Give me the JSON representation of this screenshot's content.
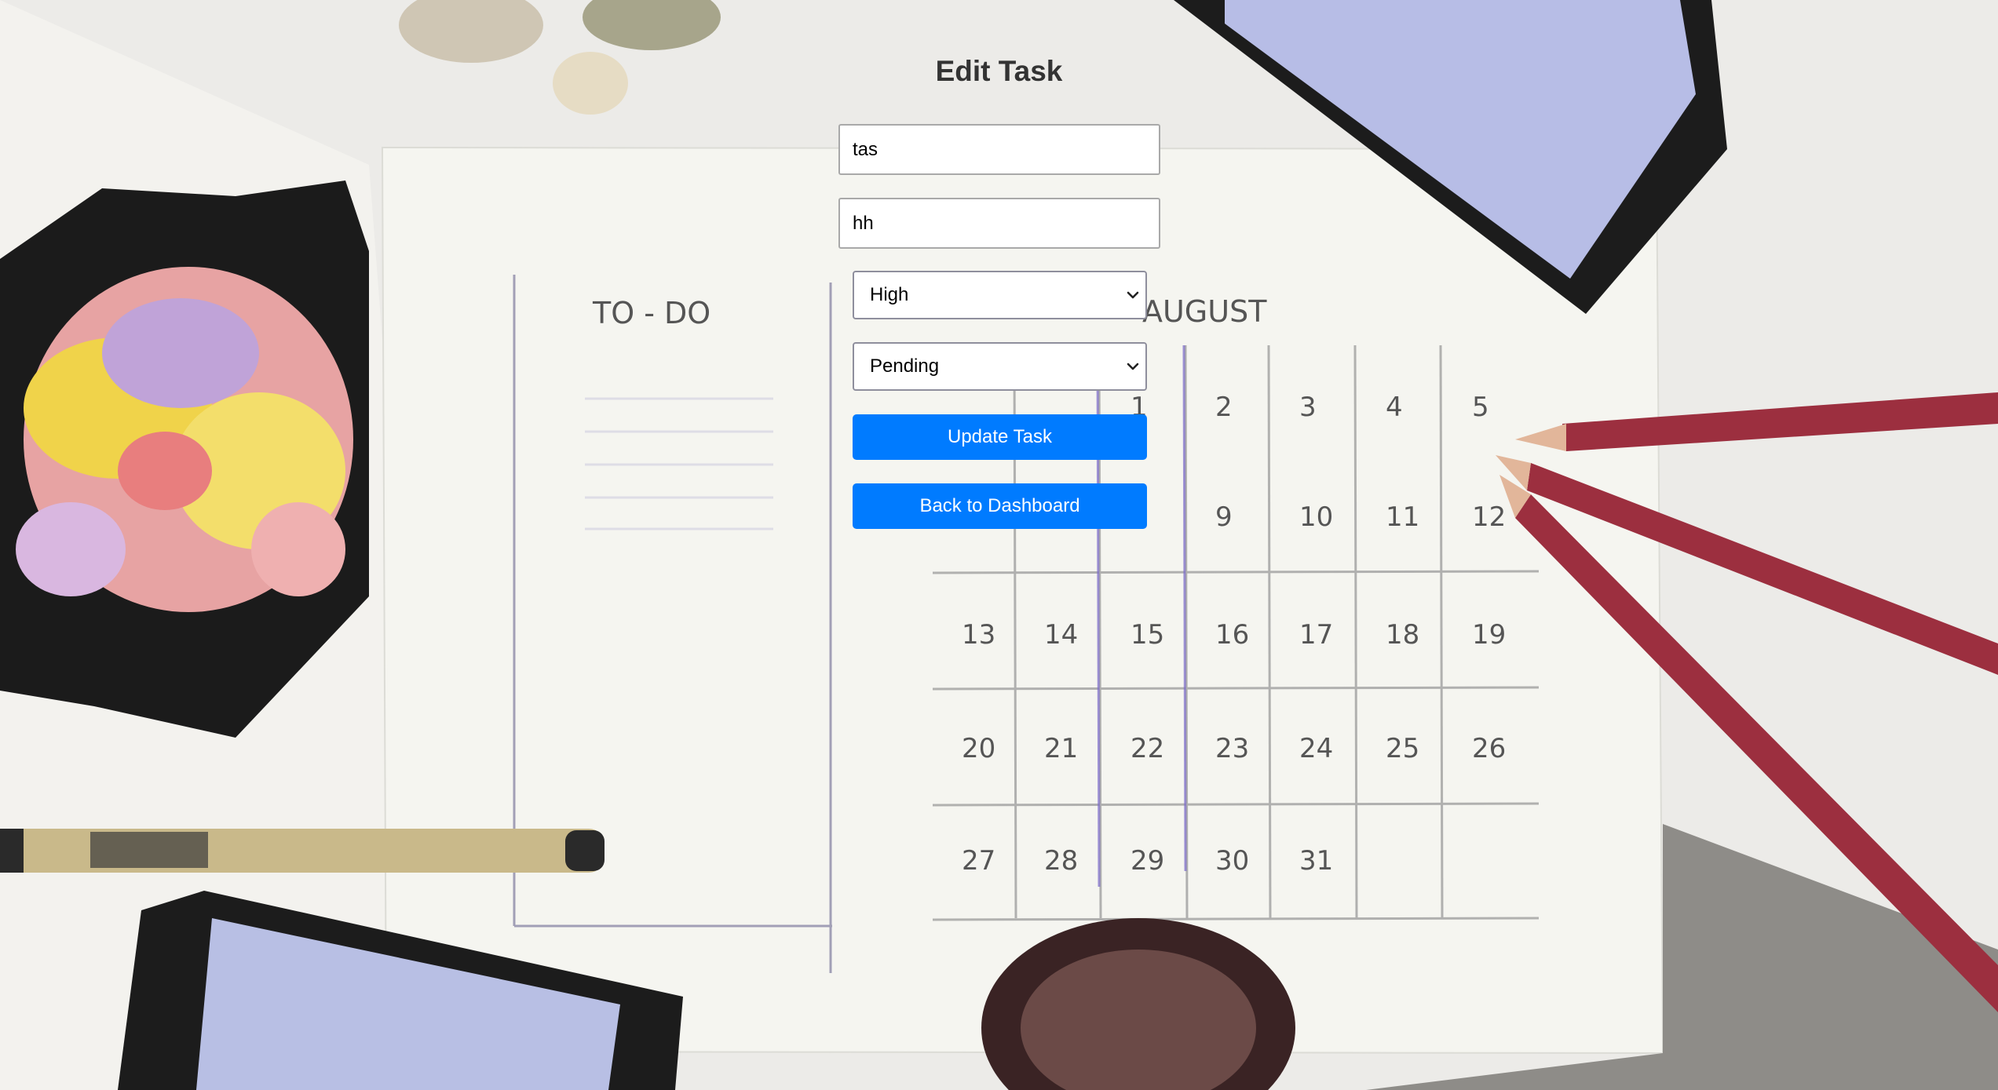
{
  "page": {
    "title": "Edit Task"
  },
  "form": {
    "title_value": "tas",
    "description_value": "hh",
    "priority": {
      "selected": "High"
    },
    "status": {
      "selected": "Pending"
    },
    "update_button_label": "Update Task",
    "back_button_label": "Back to Dashboard"
  },
  "background": {
    "calendar_month": "AUGUST",
    "todo_heading": "TO - DO",
    "calendar_days": [
      [
        "1",
        "2",
        "3",
        "4",
        "5"
      ],
      [
        "9",
        "10",
        "11",
        "12"
      ],
      [
        "13",
        "14",
        "15",
        "16",
        "17",
        "18",
        "19"
      ],
      [
        "20",
        "21",
        "22",
        "23",
        "24",
        "25",
        "26"
      ],
      [
        "27",
        "28",
        "29",
        "30",
        "31"
      ]
    ]
  },
  "colors": {
    "primary_button": "#007bff",
    "title_text": "#333333",
    "input_border": "#a9a9a9"
  }
}
